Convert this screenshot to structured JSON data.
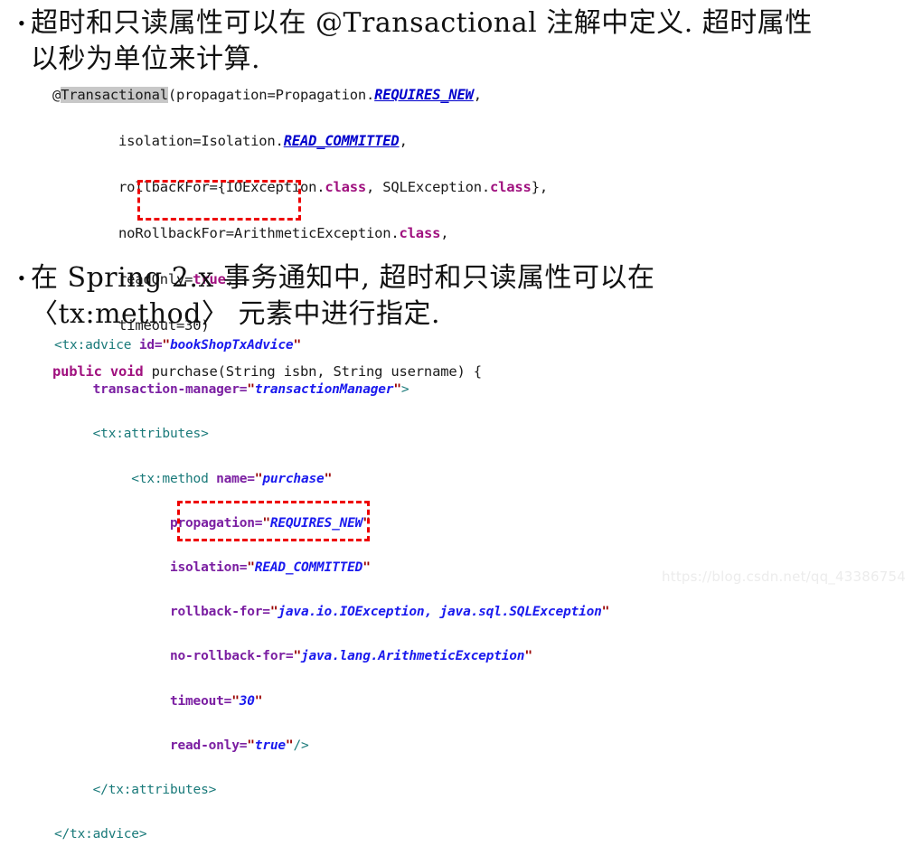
{
  "slide": {
    "background_color": "#ffffff",
    "bullets": [
      {
        "marker": "•",
        "text": "超时和只读属性可以在 @Transactional 注解中定义. 超时属性\n以秒为单位来计算."
      },
      {
        "marker": "•",
        "text": "在 Spring 2.x 事务通知中, 超时和只读属性可以在\n〈tx:method〉 元素中进行指定."
      }
    ]
  },
  "java_code": {
    "language": "java",
    "lines": [
      {
        "segments": [
          {
            "text": "@",
            "type": "plain"
          },
          {
            "text": "Transactional",
            "type": "annotation-name-highlighted"
          },
          {
            "text": "(propagation=Propagation.",
            "type": "plain"
          },
          {
            "text": "REQUIRES_NEW",
            "type": "constant"
          },
          {
            "text": ",",
            "type": "plain"
          }
        ]
      },
      {
        "segments": [
          {
            "text": "        isolation=Isolation.",
            "type": "plain"
          },
          {
            "text": "READ_COMMITTED",
            "type": "constant"
          },
          {
            "text": ",",
            "type": "plain"
          }
        ]
      },
      {
        "segments": [
          {
            "text": "        rollbackFor={IOException.",
            "type": "plain"
          },
          {
            "text": "class",
            "type": "keyword"
          },
          {
            "text": ", SQLException.",
            "type": "plain"
          },
          {
            "text": "class",
            "type": "keyword"
          },
          {
            "text": "},",
            "type": "plain"
          }
        ]
      },
      {
        "segments": [
          {
            "text": "        noRollbackFor=ArithmeticException.",
            "type": "plain"
          },
          {
            "text": "class",
            "type": "keyword"
          },
          {
            "text": ",",
            "type": "plain"
          }
        ]
      },
      {
        "segments": [
          {
            "text": "        readOnly=",
            "type": "plain"
          },
          {
            "text": "true",
            "type": "keyword"
          },
          {
            "text": ",",
            "type": "plain"
          }
        ]
      },
      {
        "segments": [
          {
            "text": "        timeout=30)",
            "type": "plain"
          }
        ]
      },
      {
        "segments": [
          {
            "text": "public void",
            "type": "keyword"
          },
          {
            "text": " purchase(String isbn, String username) {",
            "type": "plain"
          }
        ]
      }
    ]
  },
  "xml_code": {
    "language": "xml",
    "lines": [
      {
        "segments": [
          {
            "text": "<tx:advice ",
            "type": "tag"
          },
          {
            "text": "id=",
            "type": "attr"
          },
          {
            "text": "\"",
            "type": "quote"
          },
          {
            "text": "bookShopTxAdvice",
            "type": "value"
          },
          {
            "text": "\"",
            "type": "quote"
          }
        ]
      },
      {
        "segments": [
          {
            "text": "     ",
            "type": "plain"
          },
          {
            "text": "transaction-manager=",
            "type": "attr"
          },
          {
            "text": "\"",
            "type": "quote"
          },
          {
            "text": "transactionManager",
            "type": "value"
          },
          {
            "text": "\"",
            "type": "quote"
          },
          {
            "text": ">",
            "type": "tag"
          }
        ]
      },
      {
        "segments": [
          {
            "text": "     <tx:attributes>",
            "type": "tag"
          }
        ]
      },
      {
        "segments": [
          {
            "text": "          <tx:method ",
            "type": "tag"
          },
          {
            "text": "name=",
            "type": "attr"
          },
          {
            "text": "\"",
            "type": "quote"
          },
          {
            "text": "purchase",
            "type": "value"
          },
          {
            "text": "\"",
            "type": "quote"
          }
        ]
      },
      {
        "segments": [
          {
            "text": "               ",
            "type": "plain"
          },
          {
            "text": "propagation=",
            "type": "attr"
          },
          {
            "text": "\"",
            "type": "quote"
          },
          {
            "text": "REQUIRES_NEW",
            "type": "value"
          },
          {
            "text": "\"",
            "type": "quote"
          }
        ]
      },
      {
        "segments": [
          {
            "text": "               ",
            "type": "plain"
          },
          {
            "text": "isolation=",
            "type": "attr"
          },
          {
            "text": "\"",
            "type": "quote"
          },
          {
            "text": "READ_COMMITTED",
            "type": "value"
          },
          {
            "text": "\"",
            "type": "quote"
          }
        ]
      },
      {
        "segments": [
          {
            "text": "               ",
            "type": "plain"
          },
          {
            "text": "rollback-for=",
            "type": "attr"
          },
          {
            "text": "\"",
            "type": "quote"
          },
          {
            "text": "java.io.IOException, java.sql.SQLException",
            "type": "value"
          },
          {
            "text": "\"",
            "type": "quote"
          }
        ]
      },
      {
        "segments": [
          {
            "text": "               ",
            "type": "plain"
          },
          {
            "text": "no-rollback-for=",
            "type": "attr"
          },
          {
            "text": "\"",
            "type": "quote"
          },
          {
            "text": "java.lang.ArithmeticException",
            "type": "value"
          },
          {
            "text": "\"",
            "type": "quote"
          }
        ]
      },
      {
        "segments": [
          {
            "text": "               ",
            "type": "plain"
          },
          {
            "text": "timeout=",
            "type": "attr"
          },
          {
            "text": "\"",
            "type": "quote"
          },
          {
            "text": "30",
            "type": "value"
          },
          {
            "text": "\"",
            "type": "quote"
          }
        ]
      },
      {
        "segments": [
          {
            "text": "               ",
            "type": "plain"
          },
          {
            "text": "read-only=",
            "type": "attr"
          },
          {
            "text": "\"",
            "type": "quote"
          },
          {
            "text": "true",
            "type": "value"
          },
          {
            "text": "\"",
            "type": "quote"
          },
          {
            "text": "/>",
            "type": "tag"
          }
        ]
      },
      {
        "segments": [
          {
            "text": "     </tx:attributes>",
            "type": "tag"
          }
        ]
      },
      {
        "segments": [
          {
            "text": "</tx:advice>",
            "type": "tag"
          }
        ]
      }
    ]
  },
  "highlights": [
    {
      "id": "java-readonly-timeout",
      "color": "#ee0000",
      "style": "dashed"
    },
    {
      "id": "xml-timeout-readonly",
      "color": "#ee0000",
      "style": "dashed"
    }
  ],
  "watermark": {
    "text": "https://blog.csdn.net/qq_43386754",
    "color": "#ececec"
  }
}
